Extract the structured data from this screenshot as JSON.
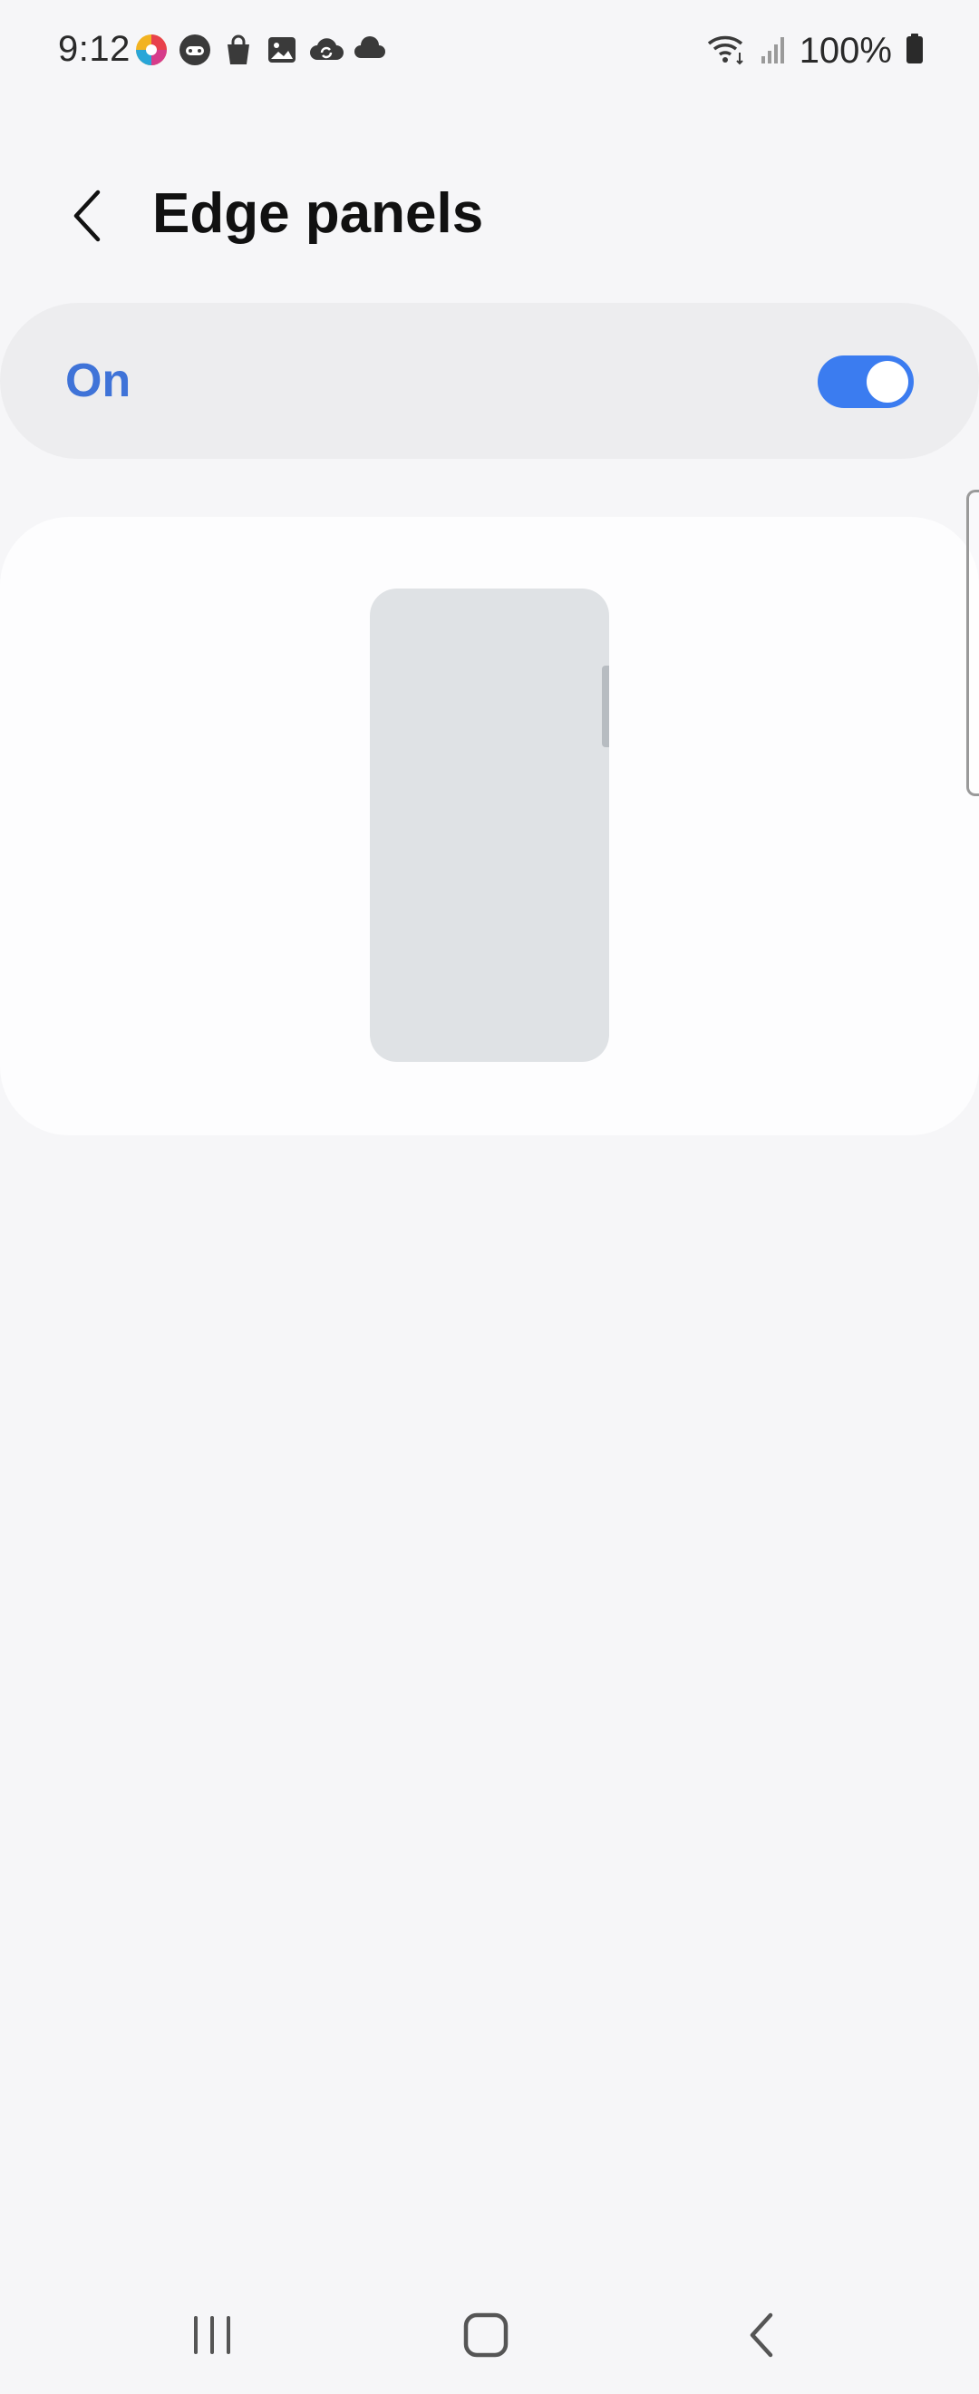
{
  "status_bar": {
    "time": "9:12",
    "left_icons": [
      "photo-app-icon",
      "game-launcher-icon",
      "shopping-bag-icon",
      "gallery-icon",
      "cloud-sync-icon",
      "cloud-icon"
    ],
    "right_icons": [
      "wifi-icon",
      "signal-icon",
      "battery-icon"
    ],
    "battery_percent": "100%"
  },
  "header": {
    "title": "Edge panels"
  },
  "master_switch": {
    "label": "On",
    "state": true,
    "accent_color": "#3b7cf0",
    "label_color": "#3f73d8"
  },
  "navigation": {
    "buttons": [
      "recents-icon",
      "home-icon",
      "back-icon"
    ]
  }
}
